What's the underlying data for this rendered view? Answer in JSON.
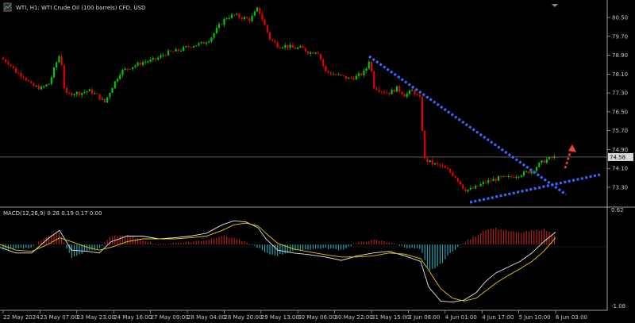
{
  "header": {
    "title": "WTI, H1:  WTI Crude Oil (100 barrels) CFD, USD",
    "icon": "chart-menu-icon"
  },
  "indicator": {
    "label": "MACD(12,26,9) 0.28 0.19 0.17 0.00"
  },
  "price_axis": {
    "ticks": [
      "80.50",
      "79.70",
      "78.90",
      "78.10",
      "77.30",
      "76.50",
      "75.70",
      "74.90",
      "74.10",
      "73.30"
    ],
    "current_price": "74.58"
  },
  "macd_axis": {
    "top": "0.62",
    "bottom": "-1.08"
  },
  "time_axis": {
    "ticks": [
      "22 May 2024",
      "23 May 07:00",
      "23 May 23:00",
      "24 May 16:00",
      "27 May 09:00",
      "28 May 04:00",
      "28 May 20:00",
      "29 May 13:00",
      "30 May 06:00",
      "30 May 22:00",
      "31 May 15:00",
      "3 Jun 08:00",
      "4 Jun 01:00",
      "4 Jun 17:00",
      "5 Jun 10:00",
      "6 Jun 03:00"
    ]
  },
  "colors": {
    "background": "#000000",
    "bull": "#00c800",
    "bear": "#e60000",
    "trendline": "#3c64ff",
    "arrow": "#ff3c3c",
    "macd_line": "#e6e6e6",
    "signal_line": "#e6c800",
    "hist_positive": "#b01e1e",
    "hist_negative": "#1ea0a8"
  },
  "chart_data": {
    "type": "candlestick",
    "symbol": "WTI",
    "timeframe": "H1",
    "y_range": [
      73.0,
      80.9
    ],
    "current_price": 74.58,
    "price_path": [
      [
        0,
        78.8
      ],
      [
        10,
        78.6
      ],
      [
        20,
        78.2
      ],
      [
        30,
        78.0
      ],
      [
        40,
        77.6
      ],
      [
        52,
        77.5
      ],
      [
        62,
        77.7
      ],
      [
        70,
        78.5
      ],
      [
        76,
        79.0
      ],
      [
        82,
        77.2
      ],
      [
        92,
        77.3
      ],
      [
        102,
        77.3
      ],
      [
        112,
        77.4
      ],
      [
        122,
        77.2
      ],
      [
        132,
        76.9
      ],
      [
        142,
        77.6
      ],
      [
        152,
        78.2
      ],
      [
        165,
        78.4
      ],
      [
        180,
        78.6
      ],
      [
        195,
        78.7
      ],
      [
        210,
        79.0
      ],
      [
        225,
        79.1
      ],
      [
        240,
        79.3
      ],
      [
        255,
        79.4
      ],
      [
        265,
        79.6
      ],
      [
        275,
        80.1
      ],
      [
        285,
        80.5
      ],
      [
        295,
        80.6
      ],
      [
        305,
        80.5
      ],
      [
        315,
        80.4
      ],
      [
        325,
        80.9
      ],
      [
        332,
        80.3
      ],
      [
        340,
        79.6
      ],
      [
        350,
        79.3
      ],
      [
        360,
        79.3
      ],
      [
        370,
        79.2
      ],
      [
        380,
        79.2
      ],
      [
        390,
        79.0
      ],
      [
        400,
        79.1
      ],
      [
        410,
        78.2
      ],
      [
        420,
        78.1
      ],
      [
        430,
        78.0
      ],
      [
        440,
        77.9
      ],
      [
        450,
        78.0
      ],
      [
        460,
        78.2
      ],
      [
        466,
        78.8
      ],
      [
        470,
        77.6
      ],
      [
        480,
        77.4
      ],
      [
        490,
        77.3
      ],
      [
        500,
        77.5
      ],
      [
        510,
        77.2
      ],
      [
        520,
        77.4
      ],
      [
        530,
        77.0
      ],
      [
        534,
        74.5
      ],
      [
        545,
        74.3
      ],
      [
        555,
        74.2
      ],
      [
        565,
        74.0
      ],
      [
        575,
        73.7
      ],
      [
        585,
        73.2
      ],
      [
        592,
        73.2
      ],
      [
        600,
        73.3
      ],
      [
        610,
        73.5
      ],
      [
        620,
        73.6
      ],
      [
        630,
        73.7
      ],
      [
        640,
        73.7
      ],
      [
        650,
        73.8
      ],
      [
        660,
        73.9
      ],
      [
        670,
        74.0
      ],
      [
        680,
        74.3
      ],
      [
        690,
        74.5
      ],
      [
        700,
        74.58
      ]
    ],
    "macd_path": [
      [
        0,
        -0.05
      ],
      [
        20,
        -0.15
      ],
      [
        40,
        -0.15
      ],
      [
        60,
        0.1
      ],
      [
        75,
        0.25
      ],
      [
        90,
        -0.1
      ],
      [
        110,
        -0.12
      ],
      [
        125,
        -0.15
      ],
      [
        140,
        0.05
      ],
      [
        160,
        0.15
      ],
      [
        180,
        0.15
      ],
      [
        200,
        0.1
      ],
      [
        220,
        0.12
      ],
      [
        240,
        0.15
      ],
      [
        260,
        0.2
      ],
      [
        280,
        0.35
      ],
      [
        295,
        0.42
      ],
      [
        310,
        0.4
      ],
      [
        325,
        0.3
      ],
      [
        335,
        0.1
      ],
      [
        350,
        -0.1
      ],
      [
        370,
        -0.15
      ],
      [
        390,
        -0.18
      ],
      [
        410,
        -0.22
      ],
      [
        430,
        -0.28
      ],
      [
        450,
        -0.2
      ],
      [
        470,
        -0.15
      ],
      [
        490,
        -0.12
      ],
      [
        510,
        -0.2
      ],
      [
        530,
        -0.3
      ],
      [
        540,
        -0.75
      ],
      [
        555,
        -1.0
      ],
      [
        570,
        -1.02
      ],
      [
        585,
        -0.98
      ],
      [
        600,
        -0.85
      ],
      [
        612,
        -0.65
      ],
      [
        625,
        -0.5
      ],
      [
        640,
        -0.4
      ],
      [
        655,
        -0.3
      ],
      [
        670,
        -0.15
      ],
      [
        685,
        0.05
      ],
      [
        700,
        0.22
      ]
    ],
    "signal_path": [
      [
        0,
        0.0
      ],
      [
        20,
        -0.1
      ],
      [
        40,
        -0.12
      ],
      [
        60,
        0.0
      ],
      [
        75,
        0.12
      ],
      [
        90,
        0.05
      ],
      [
        110,
        -0.05
      ],
      [
        125,
        -0.1
      ],
      [
        140,
        -0.05
      ],
      [
        160,
        0.05
      ],
      [
        180,
        0.1
      ],
      [
        200,
        0.1
      ],
      [
        220,
        0.1
      ],
      [
        240,
        0.12
      ],
      [
        260,
        0.15
      ],
      [
        280,
        0.25
      ],
      [
        295,
        0.35
      ],
      [
        310,
        0.38
      ],
      [
        325,
        0.33
      ],
      [
        335,
        0.2
      ],
      [
        350,
        0.02
      ],
      [
        370,
        -0.08
      ],
      [
        390,
        -0.13
      ],
      [
        410,
        -0.18
      ],
      [
        430,
        -0.22
      ],
      [
        450,
        -0.22
      ],
      [
        470,
        -0.2
      ],
      [
        490,
        -0.15
      ],
      [
        510,
        -0.17
      ],
      [
        530,
        -0.25
      ],
      [
        540,
        -0.45
      ],
      [
        555,
        -0.78
      ],
      [
        570,
        -0.95
      ],
      [
        585,
        -1.0
      ],
      [
        600,
        -0.95
      ],
      [
        612,
        -0.82
      ],
      [
        625,
        -0.68
      ],
      [
        640,
        -0.55
      ],
      [
        655,
        -0.43
      ],
      [
        670,
        -0.3
      ],
      [
        685,
        -0.12
      ],
      [
        700,
        0.12
      ]
    ],
    "macd_range": [
      -1.08,
      0.62
    ]
  }
}
